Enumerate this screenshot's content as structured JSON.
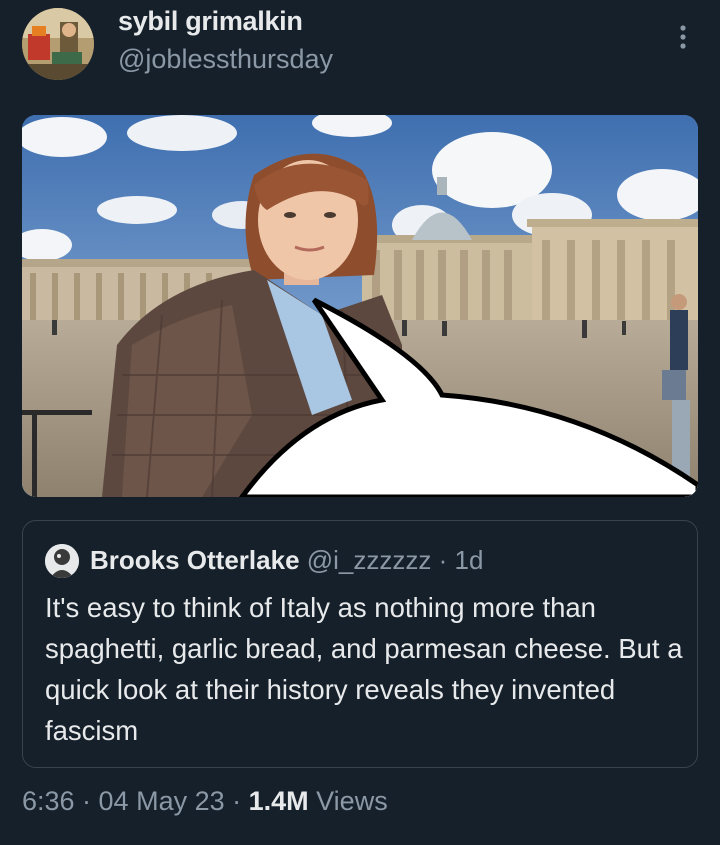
{
  "tweet": {
    "author_name": "sybil grimalkin",
    "author_handle": "@joblessthursday",
    "more_icon": "more-vertical-icon",
    "timestamp": "6:36 · 04 May 23 · ",
    "views_count": "1.4M",
    "views_label": " Views"
  },
  "quoted_tweet": {
    "author_name": "Brooks Otterlake",
    "author_handle": "@i_zzzzzz",
    "separator": " · ",
    "time": "1d",
    "text": "It's easy to think of Italy as nothing more than spaghetti, garlic bread, and parmesan cheese. But a quick look at their history reveals they invented fascism"
  },
  "colors": {
    "background": "#15202b",
    "primary_text": "#e7e9ea",
    "secondary_text": "#8b98a5",
    "border": "#38444d"
  }
}
